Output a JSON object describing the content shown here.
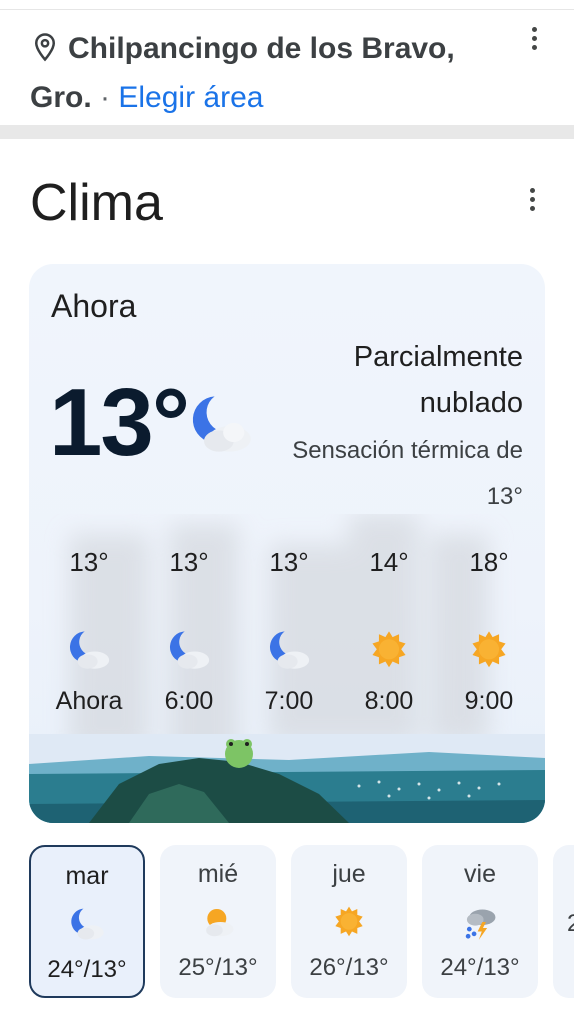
{
  "location": {
    "name": "Chilpancingo de los Bravo, Gro.",
    "separator": "·",
    "change_label": "Elegir área"
  },
  "weather": {
    "title": "Clima",
    "now_label": "Ahora",
    "temperature": "13°",
    "condition": "Parcialmente nublado",
    "feels_like": "Sensación térmica de 13°",
    "current_icon": "partly-cloudy-night-icon",
    "hourly": [
      {
        "temp": "13°",
        "time": "Ahora",
        "icon": "partly-cloudy-night-icon"
      },
      {
        "temp": "13°",
        "time": "6:00",
        "icon": "partly-cloudy-night-icon"
      },
      {
        "temp": "13°",
        "time": "7:00",
        "icon": "partly-cloudy-night-icon"
      },
      {
        "temp": "14°",
        "time": "8:00",
        "icon": "sunny-icon"
      },
      {
        "temp": "18°",
        "time": "9:00",
        "icon": "sunny-icon"
      }
    ],
    "daily": [
      {
        "day": "mar",
        "range": "24°/13°",
        "icon": "partly-cloudy-night-icon",
        "selected": true
      },
      {
        "day": "mié",
        "range": "25°/13°",
        "icon": "partly-cloudy-day-icon",
        "selected": false
      },
      {
        "day": "jue",
        "range": "26°/13°",
        "icon": "sunny-icon",
        "selected": false
      },
      {
        "day": "vie",
        "range": "24°/13°",
        "icon": "thunderstorm-icon",
        "selected": false
      },
      {
        "day": "",
        "range": "2",
        "icon": "",
        "selected": false
      }
    ]
  },
  "colors": {
    "link": "#1a73e8",
    "sun": "#f6a623",
    "moon": "#3b73e6",
    "selected_border": "#1f3a5c"
  }
}
